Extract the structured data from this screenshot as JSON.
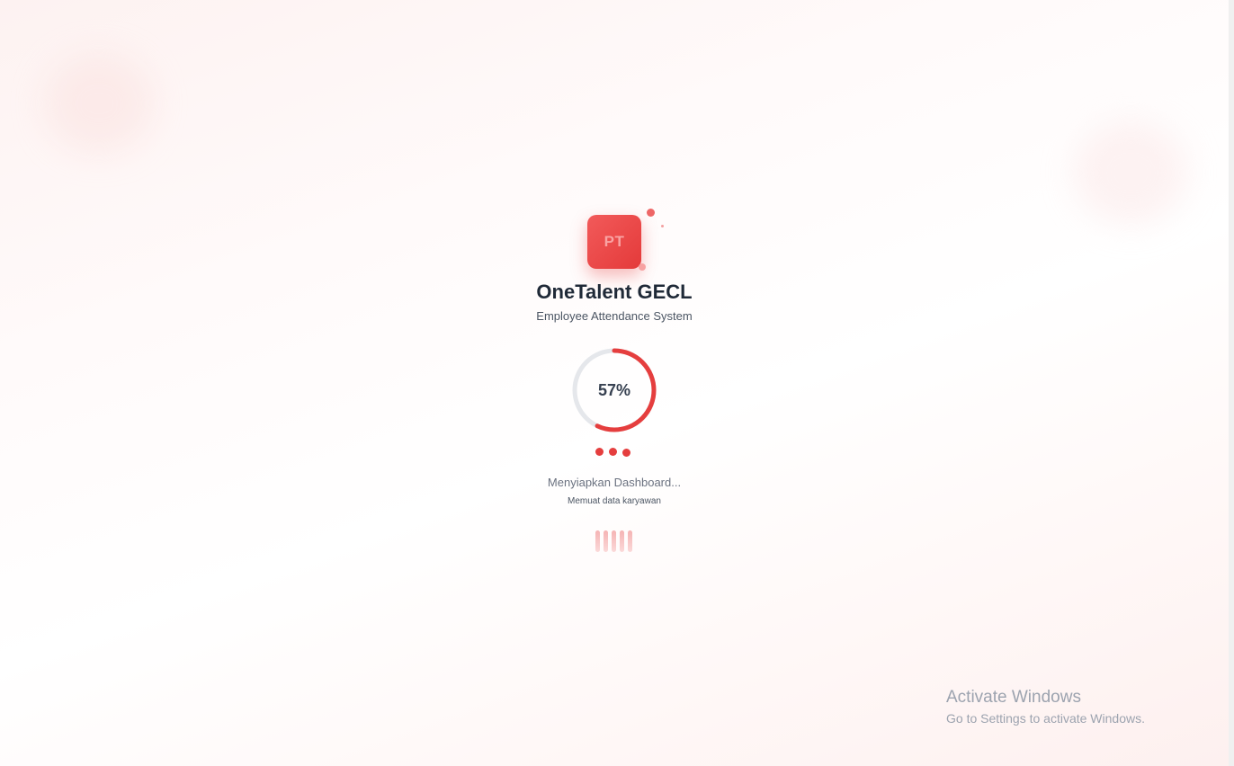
{
  "app": {
    "logo_text": "PT",
    "title": "OneTalent GECL",
    "subtitle": "Employee Attendance System"
  },
  "progress": {
    "percent": 57,
    "label": "57%"
  },
  "status": {
    "main": "Menyiapkan Dashboard...",
    "sub": "Memuat data karyawan"
  },
  "watermark": {
    "title": "Activate Windows",
    "subtitle": "Go to Settings to activate Windows."
  },
  "colors": {
    "accent": "#e53e3e",
    "ring_track": "#e5e7eb",
    "title_text": "#1f2937",
    "muted_text": "#6b7280"
  },
  "icons": {
    "logo": "pt-monogram-icon",
    "spinner": "circular-progress-icon",
    "dots": "pulse-dots-icon",
    "bars": "loading-bars-icon"
  }
}
